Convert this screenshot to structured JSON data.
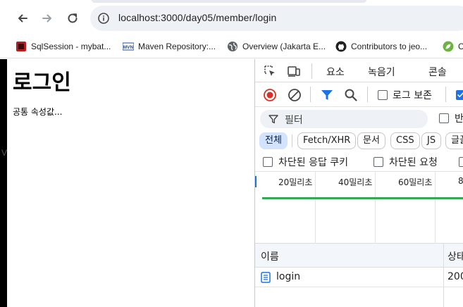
{
  "browser": {
    "url": "localhost:3000/day05/member/login",
    "bookmarks": [
      {
        "label": "SqlSession - mybat...",
        "icon": "mybatis-icon"
      },
      {
        "label": "Maven Repository:...",
        "icon": "maven-icon"
      },
      {
        "label": "Overview (Jakarta E...",
        "icon": "globe-icon"
      },
      {
        "label": "Contributors to jeo...",
        "icon": "github-icon"
      },
      {
        "label": "C",
        "icon": "green-leaf-icon"
      }
    ]
  },
  "page": {
    "title": "로그인",
    "text": "공통 속성값...",
    "edge_letter": "V"
  },
  "devtools": {
    "tabs": [
      "요소",
      "녹음기",
      "콘솔"
    ],
    "controls": {
      "preserve_log_label": "로그 보존"
    },
    "filter": {
      "placeholder": "필터",
      "invert_label": "반"
    },
    "types": [
      "전체",
      "Fetch/XHR",
      "문서",
      "CSS",
      "JS",
      "글꼴"
    ],
    "blocked": {
      "cookies_label": "차단된 응답 쿠키",
      "requests_label": "차단된 요청"
    },
    "timeline_labels": [
      "20밀리초",
      "40밀리초",
      "60밀리초",
      "8"
    ],
    "table": {
      "headers": [
        "이름",
        "상태"
      ],
      "rows": [
        {
          "name": "login",
          "status": "200"
        }
      ]
    }
  },
  "colors": {
    "accent": "#1a73e8",
    "record_red": "#d93025",
    "timeline_green": "#34a853",
    "omnibox_bg": "#eef1f6"
  }
}
